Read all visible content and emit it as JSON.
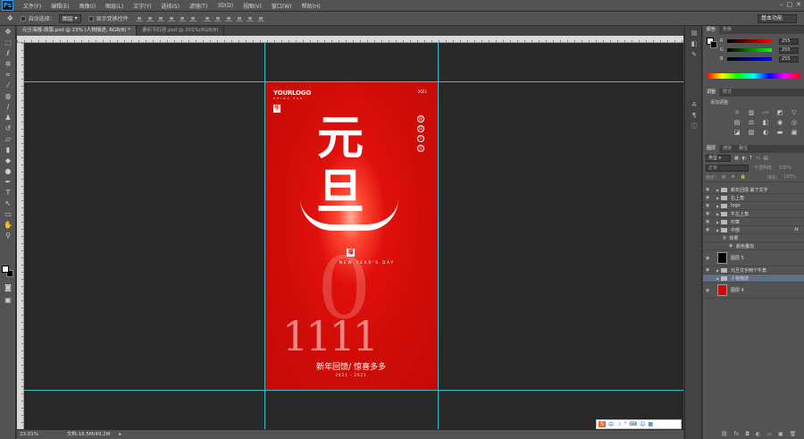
{
  "app": {
    "logo": "Ps"
  },
  "menu": [
    "文件(F)",
    "编辑(E)",
    "图像(I)",
    "图层(L)",
    "文字(Y)",
    "选择(S)",
    "滤镜(T)",
    "3D(D)",
    "视图(V)",
    "窗口(W)",
    "帮助(H)"
  ],
  "window_controls": [
    "–",
    "□",
    "✕"
  ],
  "options": {
    "auto_select_label": "自动选择：",
    "auto_select_value": "图层",
    "show_transform_label": "显示变换控件",
    "workspace": "基本功能"
  },
  "tabs": [
    {
      "label": "元旦海报-原版.psd @ 23% (人物描述, RGB/8) *",
      "active": true
    },
    {
      "label": "妻卯节红座.psd @ 201%(RGB/8)",
      "active": false
    }
  ],
  "poster": {
    "logo": "YOURLOGO",
    "logo_sub": "CHINA FAS",
    "year_top": "2021",
    "ox_char": "牛",
    "main_top": "元",
    "main_bottom": "旦",
    "mid_seal": "福",
    "new_year": "NEW YEAR'S DAY",
    "big_zero": "0",
    "ones": "1111",
    "slogan": "新年回馈/ 惊喜多多",
    "dates": "2021 · 2021",
    "right_chars": [
      "迎",
      "风",
      "下",
      "旦"
    ]
  },
  "status": {
    "zoom": "23.01%",
    "doc_info": "文档:16.5M/49.2M"
  },
  "ime": {
    "label": "中"
  },
  "color_panel": {
    "tabs": [
      "颜色",
      "色板"
    ],
    "sliders": [
      {
        "name": "R",
        "value": "255",
        "color": "#ff3b3b"
      },
      {
        "name": "G",
        "value": "255",
        "color": "#35d135"
      },
      {
        "name": "B",
        "value": "255",
        "color": "#4a62ff"
      }
    ]
  },
  "adjust_panel": {
    "tabs": [
      "调整",
      "样式"
    ],
    "title": "添加调整"
  },
  "layers_panel": {
    "tabs": [
      "图层",
      "通道",
      "路径"
    ],
    "kind_label": "类型",
    "blend": "正常",
    "opacity_label": "不透明度:",
    "opacity": "100%",
    "lock_label": "锁定:",
    "fill_label": "填充:",
    "fill": "100%",
    "layers": [
      {
        "name": "新年回馈 最下文字",
        "type": "folder"
      },
      {
        "name": "右上角",
        "type": "folder"
      },
      {
        "name": "logo",
        "type": "folder"
      },
      {
        "name": "牛左上角",
        "type": "folder"
      },
      {
        "name": "印章",
        "type": "folder"
      },
      {
        "name": "中部",
        "type": "folder"
      },
      {
        "name": "效果",
        "type": "effect"
      },
      {
        "name": "颜色叠加",
        "type": "effect"
      },
      {
        "name": "图层 5",
        "type": "thumb",
        "thumb": "#000000"
      },
      {
        "name": "元旦文字两个牛角",
        "type": "folder"
      },
      {
        "name": "人物描述",
        "type": "folder",
        "selected": true
      },
      {
        "name": "图层 4",
        "type": "thumb",
        "thumb": "#cc0a06"
      }
    ]
  }
}
